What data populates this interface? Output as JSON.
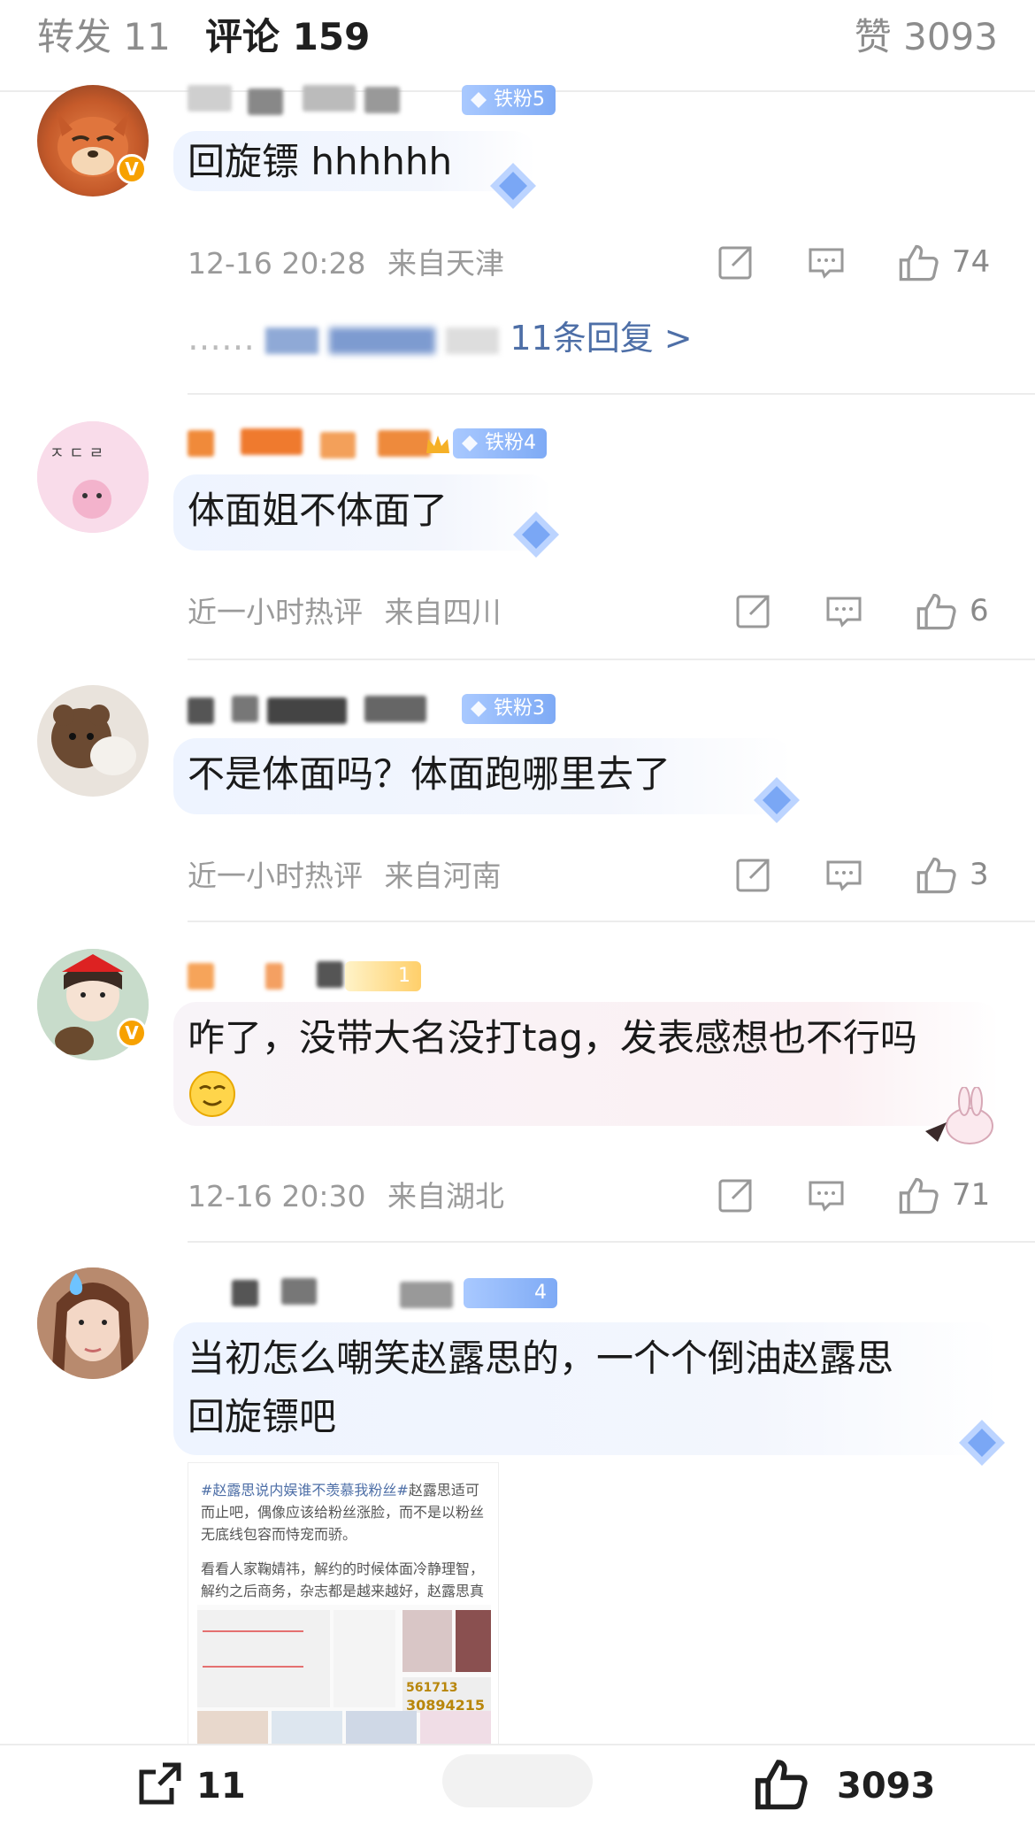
{
  "tabs": {
    "repost": "转发 11",
    "comments": "评论 159",
    "likes": "赞 3093"
  },
  "comments": [
    {
      "fan_badge": "铁粉5",
      "text": "回旋镖 hhhhhh",
      "time": "12-16 20:28",
      "location": "来自天津",
      "likes": "74",
      "replies": "11条回复 >"
    },
    {
      "fan_badge": "铁粉4",
      "text": "体面姐不体面了",
      "time": "近一小时热评",
      "location": "来自四川",
      "likes": "6"
    },
    {
      "fan_badge": "铁粉3",
      "text": "不是体面吗？体面跑哪里去了",
      "time": "近一小时热评",
      "location": "来自河南",
      "likes": "3"
    },
    {
      "fan_badge": "1",
      "text": "咋了，没带大名没打tag，发表感想也不行吗",
      "time": "12-16 20:30",
      "location": "来自湖北",
      "likes": "71"
    },
    {
      "fan_badge": "4",
      "text_line1": "当初怎么嘲笑赵露思的，一个个倒油赵露思",
      "text_line2": "回旋镖吧"
    }
  ],
  "embed": {
    "tag": "#赵露思说内娱谁不羡慕我粉丝#",
    "para1": "赵露思适可而止吧，偶像应该给粉丝涨脸，而不是以粉丝无底线包容而恃宠而骄。",
    "para2": "看看人家鞠婧祎，解约的时候体面冷静理智，解约之后商务，杂志都是越来越好，赵露思真的好好参考一下鞠婧祎面对问题时候的态度吧。",
    "stat1": "561713",
    "stat2": "30894215"
  },
  "bottom": {
    "repost_count": "11",
    "like_count": "3093"
  }
}
